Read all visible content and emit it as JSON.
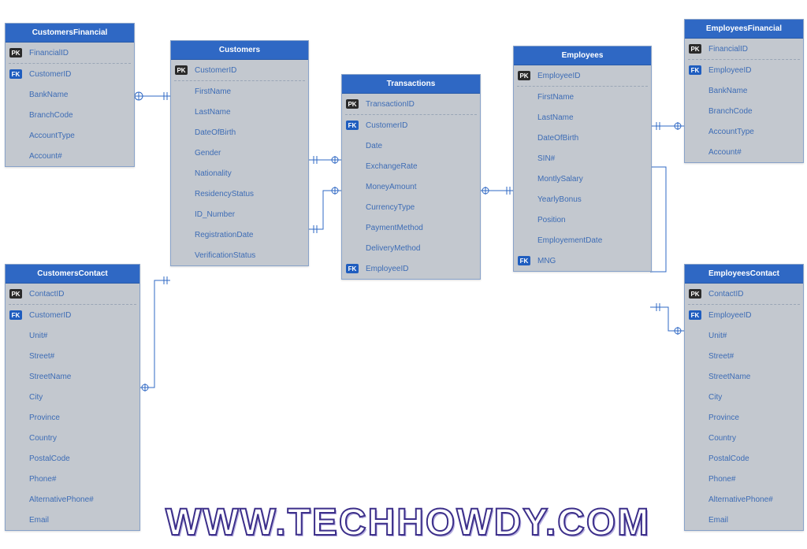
{
  "watermark": "WWW.TECHHOWDY.COM",
  "entities": {
    "customersFinancial": {
      "title": "CustomersFinancial",
      "cols": [
        {
          "key": "PK",
          "name": "FinancialID",
          "hr": true
        },
        {
          "key": "FK",
          "name": "CustomerID"
        },
        {
          "key": "",
          "name": "BankName"
        },
        {
          "key": "",
          "name": "BranchCode"
        },
        {
          "key": "",
          "name": "AccountType"
        },
        {
          "key": "",
          "name": "Account#"
        }
      ]
    },
    "customers": {
      "title": "Customers",
      "cols": [
        {
          "key": "PK",
          "name": "CustomerID",
          "hr": true
        },
        {
          "key": "",
          "name": "FirstName"
        },
        {
          "key": "",
          "name": "LastName"
        },
        {
          "key": "",
          "name": "DateOfBirth"
        },
        {
          "key": "",
          "name": "Gender"
        },
        {
          "key": "",
          "name": "Nationality"
        },
        {
          "key": "",
          "name": "ResidencyStatus"
        },
        {
          "key": "",
          "name": "ID_Number"
        },
        {
          "key": "",
          "name": "RegistrationDate"
        },
        {
          "key": "",
          "name": "VerificationStatus"
        }
      ]
    },
    "transactions": {
      "title": "Transactions",
      "cols": [
        {
          "key": "PK",
          "name": "TransactionID",
          "hr": true
        },
        {
          "key": "FK",
          "name": "CustomerID"
        },
        {
          "key": "",
          "name": "Date"
        },
        {
          "key": "",
          "name": "ExchangeRate"
        },
        {
          "key": "",
          "name": "MoneyAmount"
        },
        {
          "key": "",
          "name": "CurrencyType"
        },
        {
          "key": "",
          "name": "PaymentMethod"
        },
        {
          "key": "",
          "name": "DeliveryMethod"
        },
        {
          "key": "FK",
          "name": "EmployeeID"
        }
      ]
    },
    "employees": {
      "title": "Employees",
      "cols": [
        {
          "key": "PK",
          "name": "EmployeeID",
          "hr": true
        },
        {
          "key": "",
          "name": "FirstName"
        },
        {
          "key": "",
          "name": "LastName"
        },
        {
          "key": "",
          "name": "DateOfBirth"
        },
        {
          "key": "",
          "name": "SIN#"
        },
        {
          "key": "",
          "name": "MontlySalary"
        },
        {
          "key": "",
          "name": "YearlyBonus"
        },
        {
          "key": "",
          "name": "Position"
        },
        {
          "key": "",
          "name": "EmployementDate"
        },
        {
          "key": "FK",
          "name": "MNG"
        }
      ]
    },
    "employeesFinancial": {
      "title": "EmployeesFinancial",
      "cols": [
        {
          "key": "PK",
          "name": "FinancialID",
          "hr": true
        },
        {
          "key": "FK",
          "name": "EmployeeID"
        },
        {
          "key": "",
          "name": "BankName"
        },
        {
          "key": "",
          "name": "BranchCode"
        },
        {
          "key": "",
          "name": "AccountType"
        },
        {
          "key": "",
          "name": "Account#"
        }
      ]
    },
    "customersContact": {
      "title": "CustomersContact",
      "cols": [
        {
          "key": "PK",
          "name": "ContactID",
          "hr": true
        },
        {
          "key": "FK",
          "name": "CustomerID"
        },
        {
          "key": "",
          "name": "Unit#"
        },
        {
          "key": "",
          "name": "Street#"
        },
        {
          "key": "",
          "name": "StreetName"
        },
        {
          "key": "",
          "name": "City"
        },
        {
          "key": "",
          "name": "Province"
        },
        {
          "key": "",
          "name": "Country"
        },
        {
          "key": "",
          "name": "PostalCode"
        },
        {
          "key": "",
          "name": "Phone#"
        },
        {
          "key": "",
          "name": "AlternativePhone#"
        },
        {
          "key": "",
          "name": "Email"
        }
      ]
    },
    "employeesContact": {
      "title": "EmployeesContact",
      "cols": [
        {
          "key": "PK",
          "name": "ContactID",
          "hr": true
        },
        {
          "key": "FK",
          "name": "EmployeeID"
        },
        {
          "key": "",
          "name": "Unit#"
        },
        {
          "key": "",
          "name": "Street#"
        },
        {
          "key": "",
          "name": "StreetName"
        },
        {
          "key": "",
          "name": "City"
        },
        {
          "key": "",
          "name": "Province"
        },
        {
          "key": "",
          "name": "Country"
        },
        {
          "key": "",
          "name": "PostalCode"
        },
        {
          "key": "",
          "name": "Phone#"
        },
        {
          "key": "",
          "name": "AlternativePhone#"
        },
        {
          "key": "",
          "name": "Email"
        }
      ]
    }
  }
}
